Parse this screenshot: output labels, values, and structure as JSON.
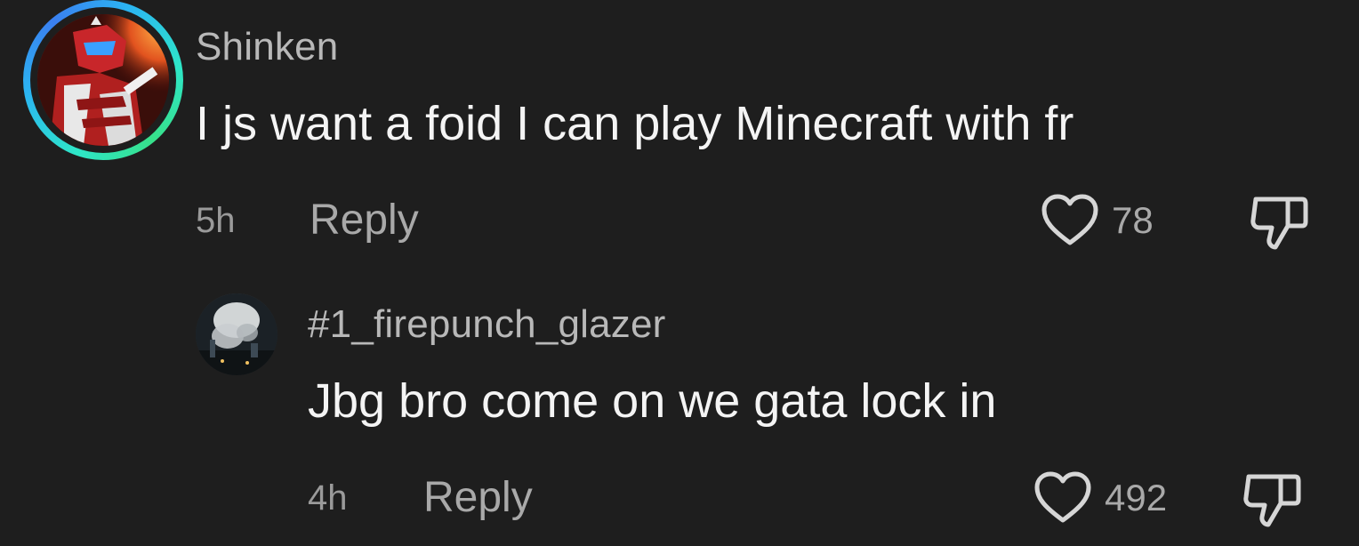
{
  "comments": [
    {
      "username": "Shinken",
      "text": "I js want a foid I can play Minecraft with fr",
      "time": "5h",
      "reply_label": "Reply",
      "likes": "78"
    },
    {
      "username": "#1_firepunch_glazer",
      "text": "Jbg bro come on we gata lock in",
      "time": "4h",
      "reply_label": "Reply",
      "likes": "492"
    }
  ],
  "icons": {
    "like": "heart-outline-icon",
    "dislike": "thumbs-down-icon"
  },
  "colors": {
    "background": "#1e1e1e",
    "username": "#b8b8b8",
    "text": "#f4f4f4",
    "muted": "#a9a9a9",
    "story_ring": "#2bb5f2"
  }
}
